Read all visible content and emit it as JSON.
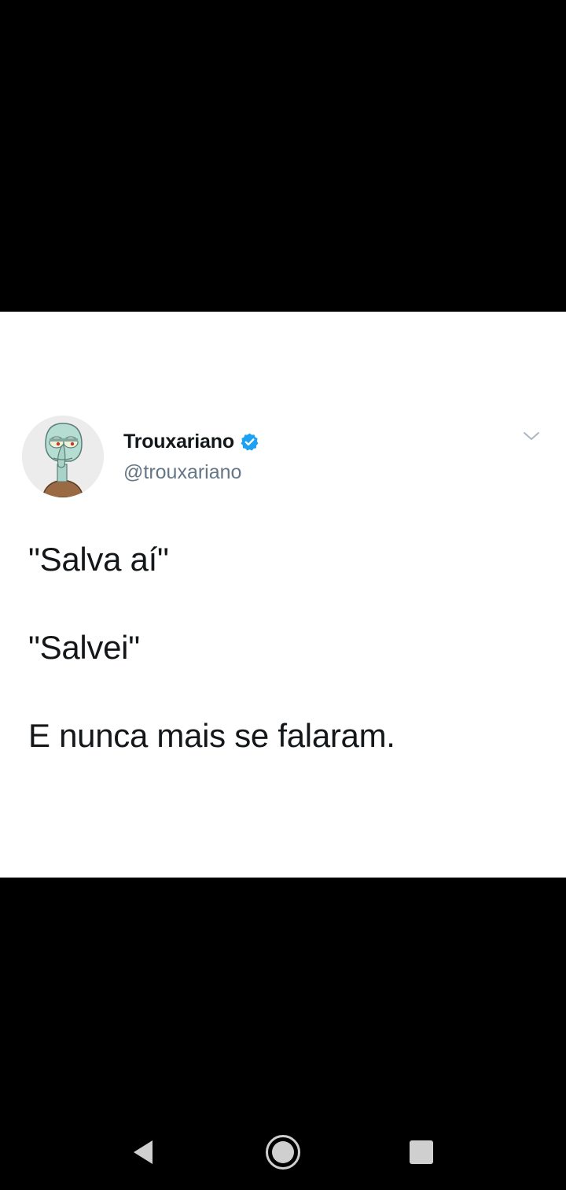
{
  "tweet": {
    "display_name": "Trouxariano",
    "handle": "@trouxariano",
    "verified": true,
    "avatar_icon": "squidward-avatar",
    "menu_icon": "chevron-down-icon",
    "lines": [
      "\"Salva aí\"",
      "\"Salvei\"",
      "E nunca mais se falaram."
    ]
  },
  "nav_bar": {
    "back_icon": "back-triangle-icon",
    "home_icon": "home-circle-icon",
    "recents_icon": "recents-square-icon"
  },
  "colors": {
    "background": "#000000",
    "card": "#ffffff",
    "text": "#14171a",
    "secondary_text": "#657786",
    "verified_blue": "#1da1f2",
    "nav_icon": "#cfcfcf"
  }
}
